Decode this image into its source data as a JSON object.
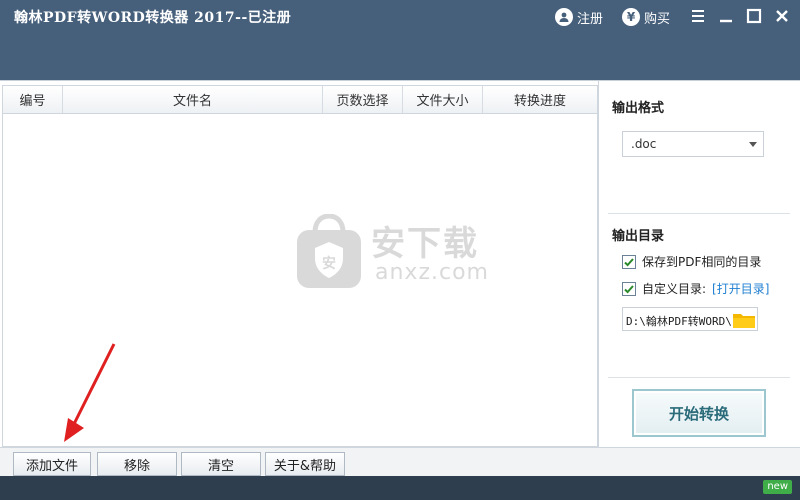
{
  "window": {
    "title": "翰林PDF转WORD转换器 2017--已注册",
    "register_label": "注册",
    "buy_label": "购买"
  },
  "table": {
    "columns": [
      "编号",
      "文件名",
      "页数选择",
      "文件大小",
      "转换进度"
    ],
    "rows": []
  },
  "watermark": {
    "text": "安下载",
    "sub": "anxz.com"
  },
  "output_format": {
    "heading": "输出格式",
    "selected": ".doc"
  },
  "output_dir": {
    "heading": "输出目录",
    "save_same_label": "保存到PDF相同的目录",
    "save_same_checked": true,
    "custom_label": "自定义目录:",
    "custom_checked": true,
    "open_dir_link": "[打开目录]",
    "path": "D:\\翰林PDF转WORD\\"
  },
  "start_button": "开始转换",
  "bottom": {
    "add_file": "添加文件",
    "remove": "移除",
    "clear": "清空",
    "about_help": "关于&帮助"
  },
  "status": {
    "badge": "new"
  },
  "colors": {
    "titlebar": "#46607c",
    "statusbar": "#2e3e4f",
    "link": "#1f7fd1",
    "badge": "#3fae49",
    "annotation_arrow": "#e02020",
    "folder": "#f5b800"
  }
}
